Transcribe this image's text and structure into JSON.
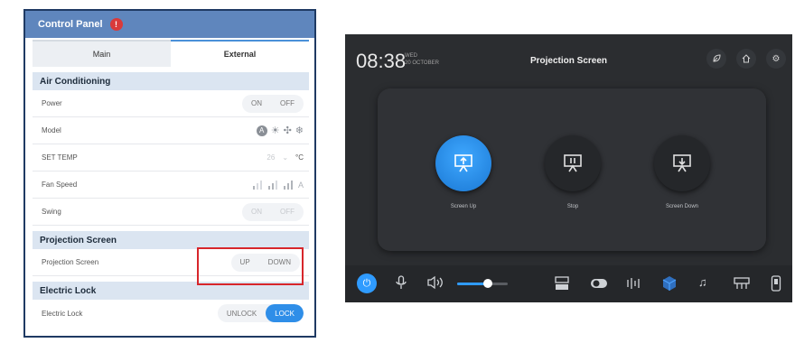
{
  "control_panel": {
    "title": "Control Panel",
    "badge": "!",
    "tabs": [
      {
        "label": "Main",
        "active": false
      },
      {
        "label": "External",
        "active": true
      }
    ],
    "air_conditioning": {
      "heading": "Air Conditioning",
      "power": {
        "label": "Power",
        "on": "ON",
        "off": "OFF"
      },
      "model": {
        "label": "Model",
        "icons": [
          "auto-mode-icon",
          "sun-icon",
          "fan-icon",
          "snowflake-icon"
        ],
        "auto_letter": "A"
      },
      "set_temp": {
        "label": "SET TEMP",
        "value": "26",
        "unit": "°C"
      },
      "fan_speed": {
        "label": "Fan Speed",
        "icons": [
          "fan-low-icon",
          "fan-mid-icon",
          "fan-high-icon",
          "fan-auto-icon"
        ],
        "auto_letter": "A"
      },
      "swing": {
        "label": "Swing",
        "on": "ON",
        "off": "OFF"
      }
    },
    "projection_screen": {
      "heading": "Projection Screen",
      "row_label": "Projection Screen",
      "up": "UP",
      "down": "DOWN"
    },
    "electric_lock": {
      "heading": "Electric Lock",
      "row_label": "Electric Lock",
      "unlock": "UNLOCK",
      "lock": "LOCK",
      "active": "LOCK"
    }
  },
  "projection_ui": {
    "time": "08:38",
    "day": "WED",
    "date": "20 OCTOBER",
    "title": "Projection Screen",
    "top_buttons": [
      "leaf-icon",
      "home-icon",
      "settings-icon"
    ],
    "controls": [
      {
        "label": "Screen Up",
        "icon": "screen-up-icon",
        "active": true
      },
      {
        "label": "Stop",
        "icon": "screen-stop-icon",
        "active": false
      },
      {
        "label": "Screen Down",
        "icon": "screen-down-icon",
        "active": false
      }
    ],
    "bottom_bar": [
      "power-icon",
      "microphone-icon",
      "speaker-icon",
      "display-icon",
      "toggle-icon",
      "equalizer-icon",
      "cube-icon",
      "music-icon",
      "projector-icon",
      "device-icon"
    ],
    "volume": 0.6,
    "accent_color": "#2f9bff"
  }
}
